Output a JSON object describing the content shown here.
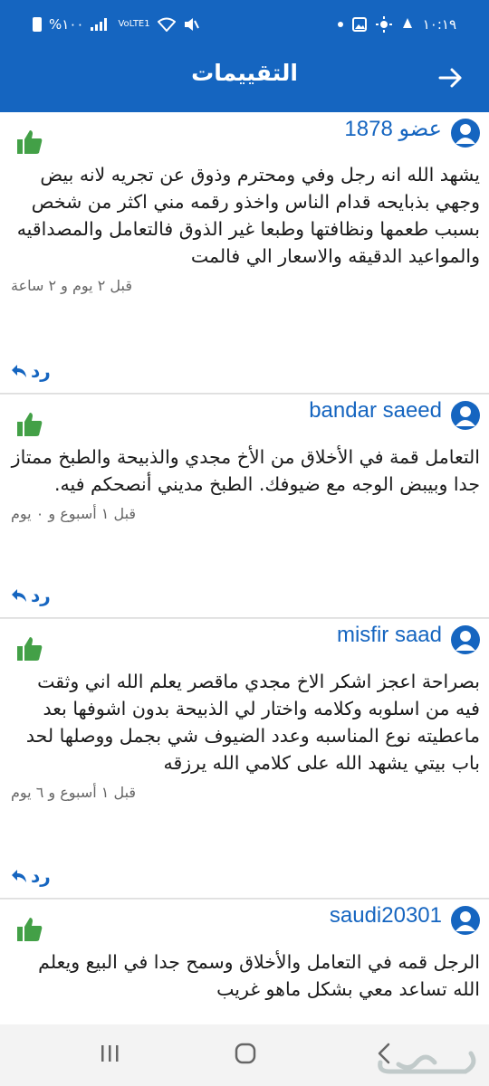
{
  "status_bar": {
    "time": "١٠:١٩",
    "battery": "%١٠٠",
    "network": "VoLTE1"
  },
  "header": {
    "title": "التقييمات"
  },
  "reviews": [
    {
      "user": "عضو 1878",
      "text": "يشهد الله انه رجل وفي ومحترم وذوق عن تجريه لانه بيض وجهي بذبايحه قدام الناس واخذو رقمه مني اكثر من شخص بسبب طعمها ونظافتها وطبعا غير الذوق فالتعامل والمصداقيه والمواعيد الدقيقه والاسعار الي فالمت",
      "time": "قبل ٢ يوم و ٢ ساعة",
      "reply_label": "رد"
    },
    {
      "user": "bandar saeed",
      "text": "التعامل قمة في الأخلاق من الأخ مجدي والذبيحة والطبخ ممتاز جدا وبيبض الوجه مع ضيوفك. الطبخ مديني أنصحكم فيه.",
      "time": "قبل ١ أسبوع و ٠ يوم",
      "reply_label": "رد"
    },
    {
      "user": "misfir saad",
      "text": "بصراحة اعجز اشكر الاخ مجدي ماقصر يعلم الله اني وثقت فيه من اسلوبه وكلامه واختار لي الذبيحة بدون اشوفها بعد ماعطيته نوع المناسبه وعدد الضيوف شي بجمل ووصلها لحد باب بيتي يشهد الله على كلامي الله يرزقه",
      "time": "قبل ١ أسبوع و ٦ يوم",
      "reply_label": "رد"
    },
    {
      "user": "saudi20301",
      "text": "الرجل قمه في التعامل والأخلاق وسمح جدا في البيع ويعلم الله تساعد معي بشكل ماهو غريب",
      "time": "",
      "reply_label": ""
    }
  ],
  "colors": {
    "primary": "#1565c0",
    "like": "#43a047",
    "text": "#1a1a1a",
    "muted": "#666666"
  },
  "icons": {
    "back": "arrow-right-icon",
    "avatar": "user-circle-icon",
    "like": "thumbs-up-icon",
    "reply": "reply-arrow-icon"
  }
}
